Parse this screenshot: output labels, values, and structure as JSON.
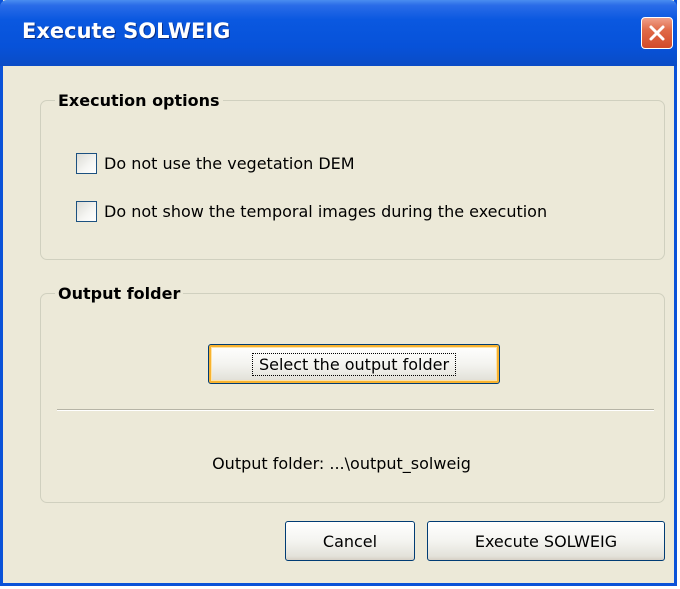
{
  "window": {
    "title": "Execute SOLWEIG",
    "close_icon": "close-icon"
  },
  "execution_options": {
    "legend": "Execution options",
    "options": [
      {
        "label": "Do not use the vegetation DEM",
        "checked": false
      },
      {
        "label": "Do not show the temporal images during the execution",
        "checked": false
      }
    ]
  },
  "output_folder": {
    "legend": "Output folder",
    "select_button_label": "Select the output folder",
    "status_text": "Output folder: ...\\output_solweig"
  },
  "footer": {
    "cancel_label": "Cancel",
    "execute_label": "Execute SOLWEIG"
  },
  "colors": {
    "titlebar": "#0752d9",
    "dialog_bg": "#ece9d8",
    "close_button": "#d24a2a",
    "focus_ring": "#f8b330"
  }
}
